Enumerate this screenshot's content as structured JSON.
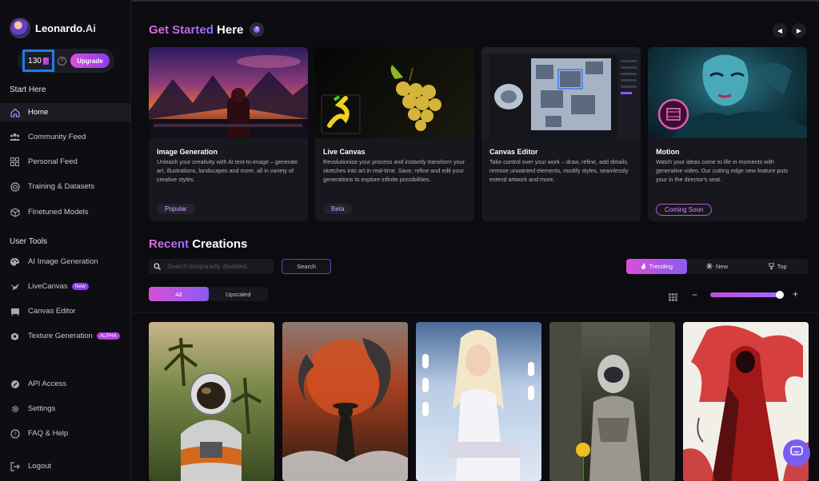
{
  "brand": {
    "name": "Leonardo",
    "suffix": ".Ai"
  },
  "credits": {
    "count": "130",
    "upgrade_label": "Upgrade",
    "help": "?"
  },
  "sidebar": {
    "start_title": "Start Here",
    "start_items": [
      {
        "label": "Home",
        "icon": "home-icon"
      },
      {
        "label": "Community Feed",
        "icon": "community-icon"
      },
      {
        "label": "Personal Feed",
        "icon": "grid-icon"
      },
      {
        "label": "Training & Datasets",
        "icon": "training-icon"
      },
      {
        "label": "Finetuned Models",
        "icon": "cube-icon"
      }
    ],
    "tools_title": "User Tools",
    "tool_items": [
      {
        "label": "AI Image Generation",
        "icon": "palette-icon"
      },
      {
        "label": "LiveCanvas",
        "icon": "bird-icon",
        "badge": "New"
      },
      {
        "label": "Canvas Editor",
        "icon": "canvas-icon"
      },
      {
        "label": "Texture Generation",
        "icon": "texture-icon",
        "badge": "ALPHA"
      }
    ],
    "bottom_items": [
      {
        "label": "API Access",
        "icon": "api-icon"
      },
      {
        "label": "Settings",
        "icon": "gear-icon"
      },
      {
        "label": "FAQ & Help",
        "icon": "help-icon"
      },
      {
        "label": "Logout",
        "icon": "logout-icon"
      }
    ]
  },
  "get_started": {
    "title_accent": "Get Started",
    "title_rest": "Here",
    "prev": "◀",
    "next": "▶",
    "cards": [
      {
        "title": "Image Generation",
        "desc": "Unleash your creativity with AI text-to-image – generate art, illustrations, landscapes and more, all in variety of creative styles.",
        "tag": "Popular"
      },
      {
        "title": "Live Canvas",
        "desc": "Revolutionise your process and instantly transform your sketches into art in real-time. Save, refine and edit your generations to explore infinite possibilities.",
        "tag": "Beta"
      },
      {
        "title": "Canvas Editor",
        "desc": "Take control over your work – draw, refine, add details, remove unwanted elements, modify styles, seamlessly extend artwork and more.",
        "tag": ""
      },
      {
        "title": "Motion",
        "desc": "Watch your ideas come to life in moments with generative video. Our cutting edge new feature puts your in the director's seat.",
        "tag": "Coming Soon"
      }
    ]
  },
  "recent": {
    "title_accent": "Recent",
    "title_rest": "Creations",
    "search_placeholder": "Search temporarily disabled.",
    "search_button": "Search",
    "sort_tabs": [
      "Trending",
      "New",
      "Top"
    ],
    "filter_tabs": [
      "All",
      "Upscaled"
    ],
    "zoom_level": 0.95,
    "zoom_minus": "−",
    "zoom_plus": "+"
  },
  "colors": {
    "accent_pink": "#d94fd8",
    "accent_purple": "#8a3cf0",
    "highlight_blue": "#1f7be8"
  }
}
